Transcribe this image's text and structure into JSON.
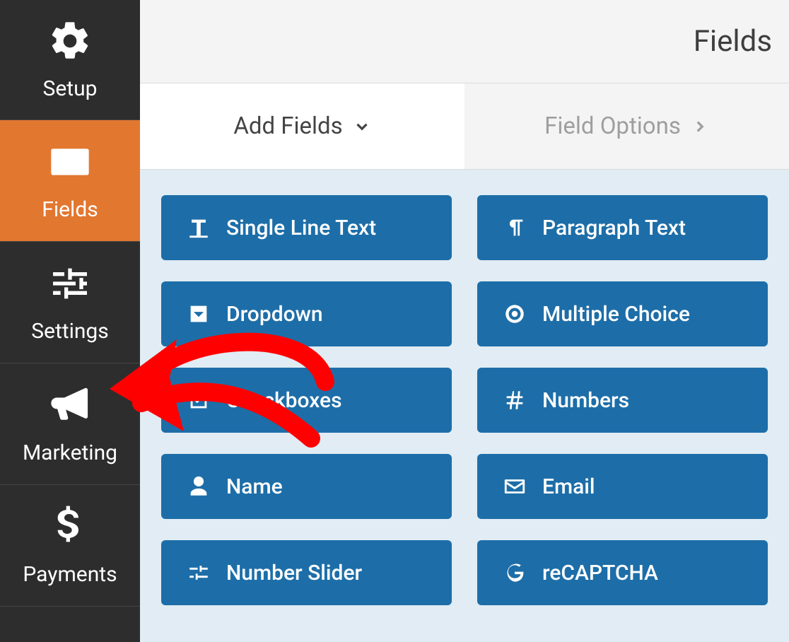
{
  "header": {
    "title": "Fields"
  },
  "sidebar": {
    "items": [
      {
        "label": "Setup"
      },
      {
        "label": "Fields"
      },
      {
        "label": "Settings"
      },
      {
        "label": "Marketing"
      },
      {
        "label": "Payments"
      }
    ]
  },
  "tabs": {
    "add": "Add Fields",
    "options": "Field Options"
  },
  "fields": {
    "single_line_text": "Single Line Text",
    "paragraph_text": "Paragraph Text",
    "dropdown": "Dropdown",
    "multiple_choice": "Multiple Choice",
    "checkboxes": "Checkboxes",
    "numbers": "Numbers",
    "name": "Name",
    "email": "Email",
    "number_slider": "Number Slider",
    "recaptcha": "reCAPTCHA"
  },
  "colors": {
    "sidebar_bg": "#2d2d2d",
    "sidebar_active": "#e27730",
    "field_btn": "#1d6ea8",
    "panel_bg": "#e1ecf4",
    "annotation": "#ff0000"
  }
}
